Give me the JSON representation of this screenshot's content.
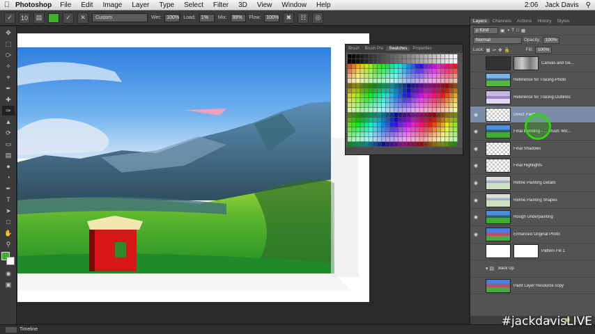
{
  "menubar": {
    "app": "Photoshop",
    "items": [
      "File",
      "Edit",
      "Image",
      "Layer",
      "Type",
      "Select",
      "Filter",
      "3D",
      "View",
      "Window",
      "Help"
    ],
    "time": "2:06",
    "user": "Jack Davis"
  },
  "options": {
    "brush_size": "10",
    "preset": "Custom",
    "wet_label": "Wet:",
    "wet_value": "100%",
    "load_label": "Load:",
    "load_value": "1%",
    "mix_label": "Mix:",
    "mix_value": "99%",
    "flow_label": "Flow:",
    "flow_value": "100%",
    "foreground_color": "#3fb02c"
  },
  "swatches_panel": {
    "tabs": [
      "Brush",
      "Brush Pre",
      "Swatches",
      "Properties"
    ],
    "active_tab": "Swatches"
  },
  "layers_panel": {
    "tabs": [
      "Layers",
      "Channels",
      "Actions",
      "History",
      "Styles"
    ],
    "kind_label": "ρ Kind",
    "blend_mode": "Normal",
    "opacity_label": "Opacity:",
    "opacity_value": "100%",
    "lock_label": "Lock:",
    "fill_label": "Fill:",
    "fill_value": "100%",
    "layers": [
      {
        "name": "Canvas and Ge...",
        "visible": false,
        "thumb": "gray",
        "selected": false
      },
      {
        "name": "Reference for Tracing-Photo",
        "visible": false,
        "thumb": "photo",
        "selected": false
      },
      {
        "name": "Reference for Tracing-Outlines",
        "visible": false,
        "thumb": "outline",
        "selected": false
      },
      {
        "name": "Direct Paint",
        "visible": true,
        "thumb": "blank",
        "selected": true
      },
      {
        "name": "Final Blending - ... brush: Wo...",
        "visible": true,
        "thumb": "paint",
        "selected": false
      },
      {
        "name": "Final Shadows",
        "visible": true,
        "thumb": "blank",
        "selected": false
      },
      {
        "name": "Final Highlights",
        "visible": true,
        "thumb": "blank",
        "selected": false
      },
      {
        "name": "Refine Painting Details",
        "visible": true,
        "thumb": "sketch",
        "selected": false
      },
      {
        "name": "Refine Painting Shapes",
        "visible": true,
        "thumb": "sketch",
        "selected": false
      },
      {
        "name": "Rough Underpainting",
        "visible": true,
        "thumb": "paint",
        "selected": false
      },
      {
        "name": "Enhanced Original Photo",
        "visible": true,
        "thumb": "enh",
        "selected": false
      },
      {
        "name": "Pattern Fill 1",
        "visible": false,
        "thumb": "white",
        "selected": false
      },
      {
        "name": "Back Up",
        "visible": false,
        "thumb": "folder",
        "selected": false
      },
      {
        "name": "Paint Layer Resource copy",
        "visible": false,
        "thumb": "enh",
        "selected": false
      }
    ]
  },
  "timeline": {
    "label": "Timeline"
  },
  "watermark": "#jackdavisLIVE"
}
